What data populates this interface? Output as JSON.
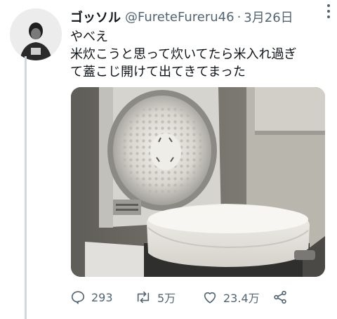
{
  "tweet": {
    "display_name": "ゴッソル",
    "handle": "@FureteFureru46",
    "separator": "·",
    "date": "3月26日",
    "text_lines": [
      "やべえ",
      "米炊こうと思って炊いてたら米入れ過ぎ",
      "て蓋こじ開けて出てきてまった"
    ],
    "media": {
      "subject": "rice-cooker-overflowing-rice"
    },
    "actions": {
      "reply_count": "293",
      "retweet_count": "5万",
      "like_count": "23.4万"
    }
  },
  "colors": {
    "text": "#0f1419",
    "secondary": "#536471",
    "thread_line": "#cfd9de",
    "background": "#ffffff"
  }
}
